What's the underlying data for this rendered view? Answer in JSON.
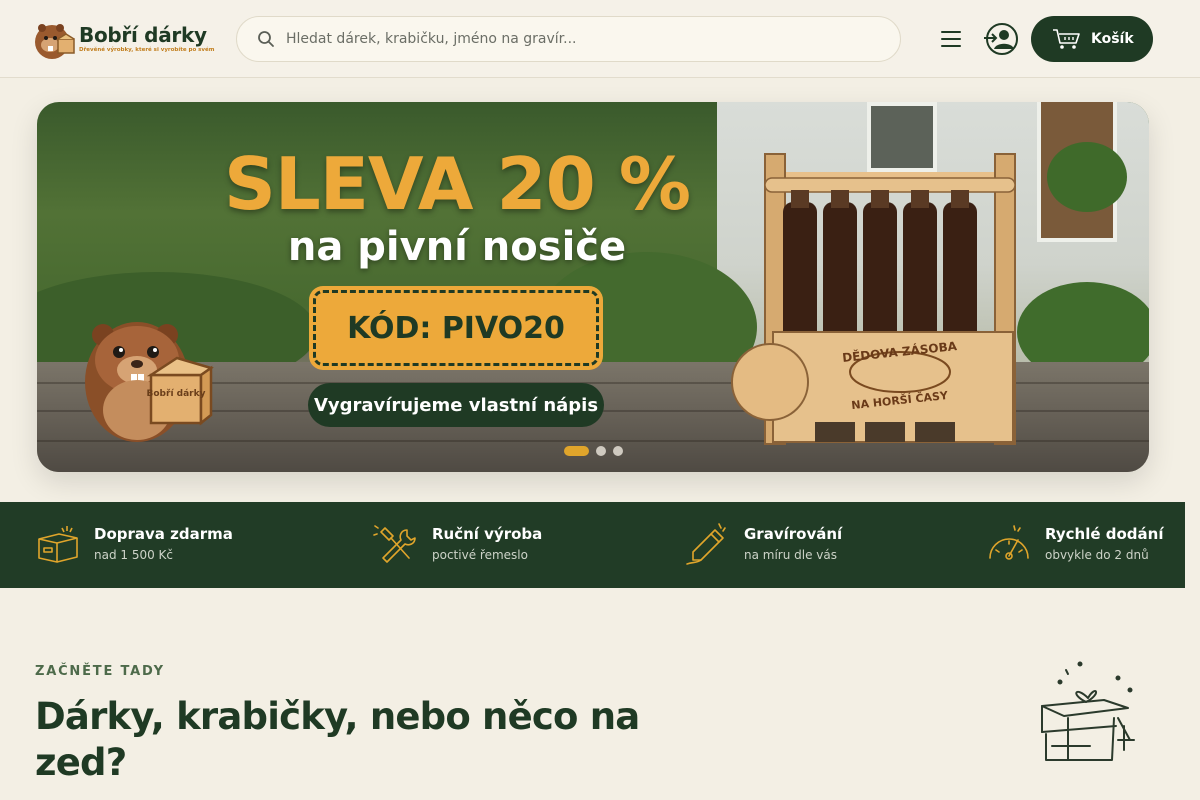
{
  "header": {
    "logo_title": "Bobří dárky",
    "logo_tagline": "Dřevěné výrobky, které si vyrobíte po svém",
    "search_placeholder": "Hledat dárek, krabičku, jméno na gravír...",
    "cart_label": "Košík"
  },
  "hero": {
    "title": "SLEVA 20 %",
    "subtitle": "na pivní nosiče",
    "code_label": "KÓD: PIVO20",
    "cta_label": "Vygravírujeme vlastní nápis",
    "box_engraving": "Bobří dárky",
    "carrier_engraving_top": "DĚDOVA ZÁSOBA",
    "carrier_engraving_bottom": "NA HORŠÍ ČASY",
    "slides": {
      "count": 3,
      "active": 1
    }
  },
  "features": [
    {
      "title": "Doprava zdarma",
      "subtitle": "nad 1 500 Kč",
      "icon": "box-icon"
    },
    {
      "title": "Ruční výroba",
      "subtitle": "poctivé řemeslo",
      "icon": "tools-icon"
    },
    {
      "title": "Gravírování",
      "subtitle": "na míru dle vás",
      "icon": "pencil-icon"
    },
    {
      "title": "Rychlé dodání",
      "subtitle": "obvykle do 2 dnů",
      "icon": "speedometer-icon"
    }
  ],
  "section": {
    "eyebrow": "ZAČNĚTE TADY",
    "title": "Dárky, krabičky, nebo něco na zed?"
  },
  "colors": {
    "brand_green": "#1f3a24",
    "accent_orange": "#eda93a",
    "background": "#f3efe4"
  }
}
